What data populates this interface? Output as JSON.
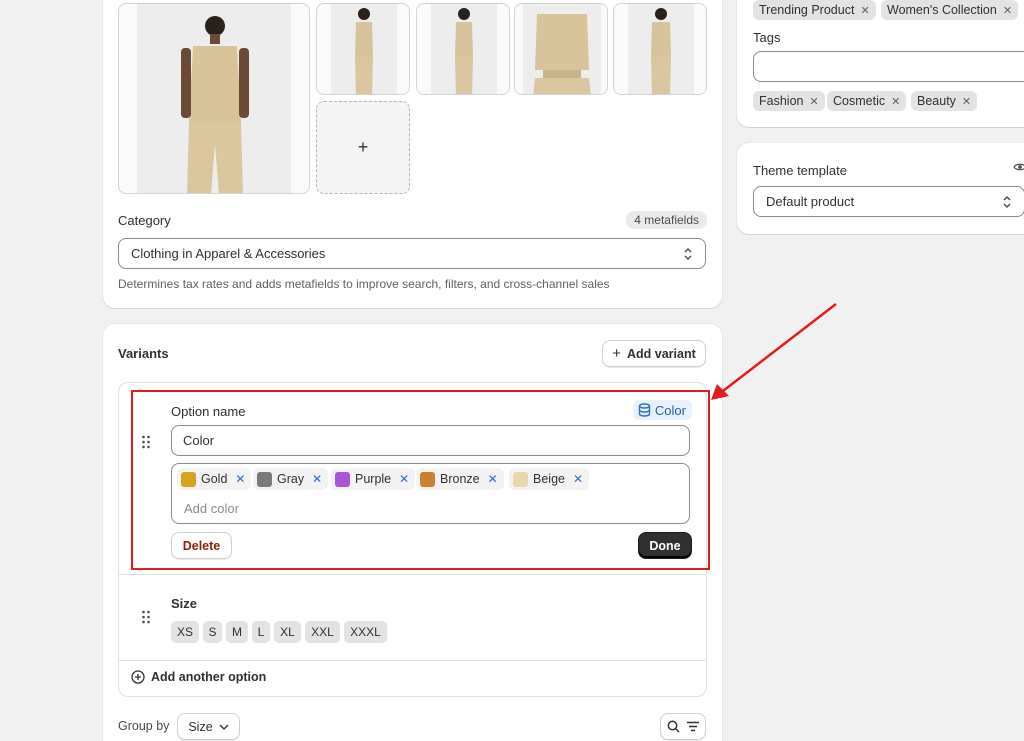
{
  "media": {
    "add_label": "+"
  },
  "category": {
    "label": "Category",
    "metafields_badge": "4 metafields",
    "value": "Clothing in Apparel & Accessories",
    "help": "Determines tax rates and adds metafields to improve search, filters, and cross-channel sales"
  },
  "variants": {
    "title": "Variants",
    "add_variant_label": "Add variant",
    "option_name_label": "Option name",
    "metafield_link_label": "Color",
    "option_name_value": "Color",
    "colors": [
      {
        "name": "Gold",
        "hex": "#d9a21b"
      },
      {
        "name": "Gray",
        "hex": "#7b7b7b"
      },
      {
        "name": "Purple",
        "hex": "#a855d6"
      },
      {
        "name": "Bronze",
        "hex": "#cd7f32"
      },
      {
        "name": "Beige",
        "hex": "#e9d7a8"
      }
    ],
    "add_color_placeholder": "Add color",
    "delete_label": "Delete",
    "done_label": "Done",
    "size_title": "Size",
    "sizes": [
      "XS",
      "S",
      "M",
      "L",
      "XL",
      "XXL",
      "XXXL"
    ],
    "add_another_option_label": "Add another option",
    "group_by_label": "Group by",
    "group_by_value": "Size"
  },
  "tags_card": {
    "collections": [
      "Trending Product",
      "Women's Collection"
    ],
    "tags_label": "Tags",
    "tags_input_value": "",
    "tags": [
      "Fashion",
      "Cosmetic",
      "Beauty"
    ]
  },
  "theme": {
    "label": "Theme template",
    "value": "Default product"
  },
  "colors": {
    "highlight": "#e31b1b",
    "link_blue": "#2c6ecb",
    "delete_red": "#8e1f0b",
    "done_dark": "#303030"
  }
}
